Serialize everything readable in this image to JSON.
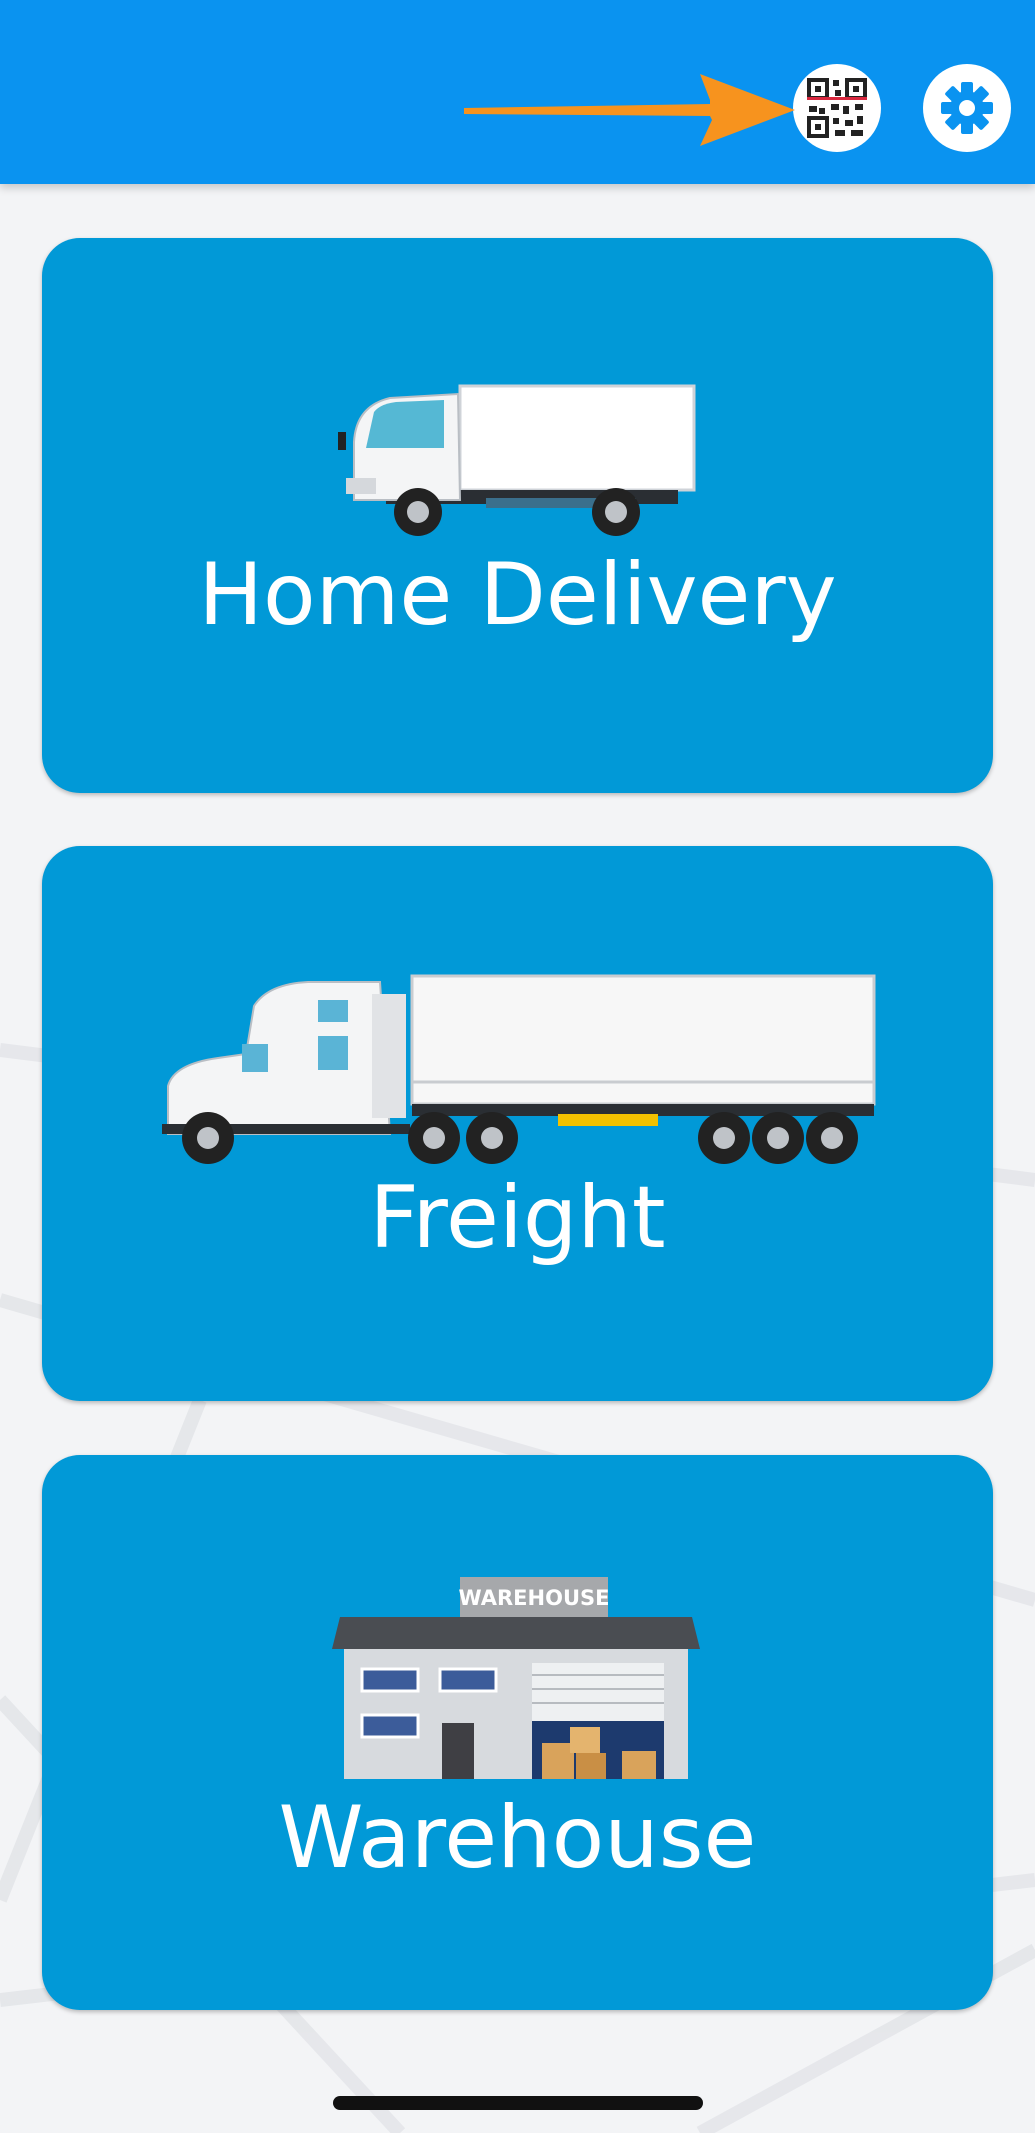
{
  "header": {
    "qr_button_icon": "qr-code-icon",
    "settings_button_icon": "gear-icon",
    "annotation_icon": "arrow-right-icon",
    "background_color": "#0a93f0"
  },
  "cards": [
    {
      "label": "Home Delivery",
      "icon": "delivery-truck-icon"
    },
    {
      "label": "Freight",
      "icon": "semi-truck-icon"
    },
    {
      "label": "Warehouse",
      "icon": "warehouse-icon",
      "sign_text": "WAREHOUSE"
    }
  ],
  "colors": {
    "card": "#0199d7",
    "accent_arrow": "#f7931e"
  }
}
